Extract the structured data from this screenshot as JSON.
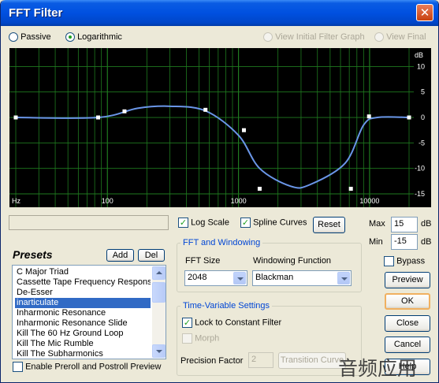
{
  "window": {
    "title": "FFT Filter",
    "close_symbol": "✕"
  },
  "mode": {
    "passive_label": "Passive",
    "logarithmic_label": "Logarithmic",
    "selected": "logarithmic"
  },
  "view": {
    "initial_label": "View Initial Filter Graph",
    "final_label": "View Final"
  },
  "graph": {
    "y_unit": "dB",
    "y_ticks": [
      "10",
      "5",
      "0",
      "-5",
      "-10",
      "-15"
    ],
    "x_unit": "Hz",
    "x_ticks": [
      "100",
      "1000",
      "10000"
    ],
    "ylim": [
      -15,
      13
    ],
    "control_points": [
      {
        "hz": 20,
        "db": 0
      },
      {
        "hz": 85,
        "db": 0
      },
      {
        "hz": 135,
        "db": 1.2
      },
      {
        "hz": 560,
        "db": 1.5
      },
      {
        "hz": 1100,
        "db": -2.5
      },
      {
        "hz": 1450,
        "db": -14
      },
      {
        "hz": 7200,
        "db": -14
      },
      {
        "hz": 9900,
        "db": 0.2
      },
      {
        "hz": 20000,
        "db": 0
      }
    ],
    "colors": {
      "background": "#000000",
      "grid": "#1F7A1F",
      "curve": "#6A96E8",
      "point": "#FFFFFF"
    }
  },
  "options": {
    "log_scale_label": "Log Scale",
    "log_scale_checked": true,
    "spline_label": "Spline Curves",
    "spline_checked": true,
    "reset_label": "Reset"
  },
  "range": {
    "max_label": "Max",
    "max_value": "15",
    "max_unit": "dB",
    "min_label": "Min",
    "min_value": "-15",
    "min_unit": "dB"
  },
  "fft": {
    "group_title": "FFT and Windowing",
    "size_label": "FFT Size",
    "size_value": "2048",
    "window_label": "Windowing Function",
    "window_value": "Blackman"
  },
  "time_variable": {
    "group_title": "Time-Variable Settings",
    "lock_label": "Lock to Constant Filter",
    "lock_checked": true,
    "morph_label": "Morph",
    "precision_label": "Precision Factor",
    "precision_value": "2",
    "transition_label": "Transition Curve"
  },
  "presets": {
    "heading": "Presets",
    "add_label": "Add",
    "del_label": "Del",
    "items": [
      "C Major Triad",
      "Cassette Tape Frequency Response",
      "De-Esser",
      "inarticulate",
      "Inharmonic Resonance",
      "Inharmonic Resonance Slide",
      "Kill The 60 Hz  Ground Loop",
      "Kill The Mic Rumble",
      "Kill The Subharmonics"
    ],
    "selected_index": 3,
    "preroll_label": "Enable Preroll and Postroll Preview"
  },
  "side_buttons": {
    "bypass_label": "Bypass",
    "preview_label": "Preview",
    "ok_label": "OK",
    "close_label": "Close",
    "cancel_label": "Cancel",
    "help_label": "Help"
  },
  "watermark": "音频应用"
}
